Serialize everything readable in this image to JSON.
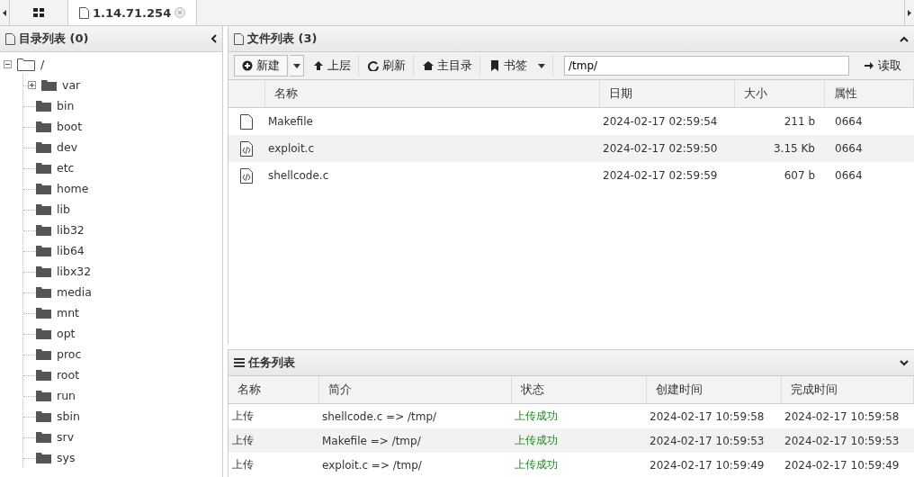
{
  "tabs": [
    {
      "kind": "home",
      "selected": false
    },
    {
      "kind": "host",
      "label": "1.14.71.254",
      "selected": true
    }
  ],
  "dir_panel": {
    "title": "目录列表 (0)",
    "tree": [
      {
        "label": "/",
        "expanded": true,
        "children": [
          {
            "label": "var",
            "expanded": false
          },
          {
            "label": "bin"
          },
          {
            "label": "boot"
          },
          {
            "label": "dev"
          },
          {
            "label": "etc"
          },
          {
            "label": "home"
          },
          {
            "label": "lib"
          },
          {
            "label": "lib32"
          },
          {
            "label": "lib64"
          },
          {
            "label": "libx32"
          },
          {
            "label": "media"
          },
          {
            "label": "mnt"
          },
          {
            "label": "opt"
          },
          {
            "label": "proc"
          },
          {
            "label": "root"
          },
          {
            "label": "run"
          },
          {
            "label": "sbin"
          },
          {
            "label": "srv"
          },
          {
            "label": "sys"
          }
        ]
      }
    ]
  },
  "file_panel": {
    "title": "文件列表 (3)",
    "toolbar": [
      {
        "kind": "new",
        "label": "新建"
      },
      {
        "kind": "up",
        "label": "上层"
      },
      {
        "kind": "refresh",
        "label": "刷新"
      },
      {
        "kind": "home",
        "label": "主目录"
      },
      {
        "kind": "bookmark",
        "label": "书签"
      }
    ],
    "path": "/tmp/",
    "read_button": "读取",
    "columns": [
      "名称",
      "日期",
      "大小",
      "属性"
    ],
    "rows": [
      {
        "kind": "text",
        "name": "Makefile",
        "date": "2024-02-17 02:59:54",
        "size": "211 b",
        "mode": "0664",
        "selected": false
      },
      {
        "kind": "code",
        "name": "exploit.c",
        "date": "2024-02-17 02:59:50",
        "size": "3.15 Kb",
        "mode": "0664",
        "selected": true
      },
      {
        "kind": "code",
        "name": "shellcode.c",
        "date": "2024-02-17 02:59:59",
        "size": "607 b",
        "mode": "0664",
        "selected": false
      }
    ]
  },
  "task_panel": {
    "title": "任务列表",
    "columns": [
      "名称",
      "简介",
      "状态",
      "创建时间",
      "完成时间"
    ],
    "rows": [
      {
        "name": "上传",
        "desc": "shellcode.c => /tmp/",
        "status": "上传成功",
        "created": "2024-02-17 10:59:58",
        "finished": "2024-02-17 10:59:58",
        "selected": false
      },
      {
        "name": "上传",
        "desc": "Makefile => /tmp/",
        "status": "上传成功",
        "created": "2024-02-17 10:59:53",
        "finished": "2024-02-17 10:59:53",
        "selected": true
      },
      {
        "name": "上传",
        "desc": "exploit.c => /tmp/",
        "status": "上传成功",
        "created": "2024-02-17 10:59:49",
        "finished": "2024-02-17 10:59:49",
        "selected": false
      }
    ]
  }
}
